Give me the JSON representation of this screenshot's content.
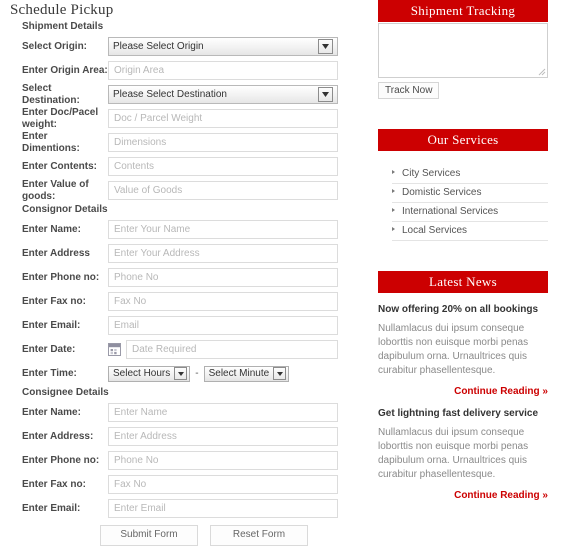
{
  "theme": {
    "accent_red": "#cc0001",
    "label_color": "#4a4a4a",
    "placeholder_color": "#b8b8b8"
  },
  "left": {
    "page_title": "Schedule Pickup",
    "shipment_section_label": "Shipment Details",
    "consignor_section_label": "Consignor Details",
    "consignee_section_label": "Consignee Details",
    "shipment_fields": [
      {
        "label": "Select Origin:",
        "type": "select",
        "value": "Please Select Origin",
        "icon": "chevron-down-icon"
      },
      {
        "label": "Enter Origin Area:",
        "type": "text",
        "placeholder": "Origin Area"
      },
      {
        "label": "Select Destination:",
        "type": "select",
        "value": "Please Select Destination",
        "icon": "chevron-down-icon"
      },
      {
        "label": "Enter Doc/Pacel weight:",
        "type": "text",
        "placeholder": "Doc / Parcel Weight"
      },
      {
        "label": "Enter Dimentions:",
        "type": "text",
        "placeholder": "Dimensions"
      },
      {
        "label": "Enter Contents:",
        "type": "text",
        "placeholder": "Contents"
      },
      {
        "label": "Enter Value of goods:",
        "type": "text",
        "placeholder": "Value of Goods"
      }
    ],
    "consignor_fields": [
      {
        "label": "Enter Name:",
        "type": "text",
        "placeholder": "Enter Your Name"
      },
      {
        "label": "Enter Address",
        "type": "text",
        "placeholder": "Enter Your Address"
      },
      {
        "label": "Enter Phone no:",
        "type": "text",
        "placeholder": "Phone No"
      },
      {
        "label": "Enter Fax no:",
        "type": "text",
        "placeholder": "Fax No"
      },
      {
        "label": "Enter Email:",
        "type": "text",
        "placeholder": "Email"
      }
    ],
    "date_field": {
      "label": "Enter Date:",
      "placeholder": "Date Required",
      "icon": "calendar-icon"
    },
    "time_field": {
      "label": "Enter Time:",
      "hours_value": "Select Hours",
      "separator": "-",
      "minutes_value": "Select Minute",
      "icon": "chevron-down-icon"
    },
    "consignee_fields": [
      {
        "label": "Enter Name:",
        "type": "text",
        "placeholder": "Enter Name"
      },
      {
        "label": "Enter Address:",
        "type": "text",
        "placeholder": "Enter Address"
      },
      {
        "label": "Enter Phone no:",
        "type": "text",
        "placeholder": "Phone No"
      },
      {
        "label": "Enter Fax no:",
        "type": "text",
        "placeholder": "Fax No"
      },
      {
        "label": "Enter Email:",
        "type": "text",
        "placeholder": "Enter Email"
      }
    ],
    "submit_label": "Submit Form",
    "reset_label": "Reset Form"
  },
  "right": {
    "tracking": {
      "header": "Shipment Tracking",
      "textarea_value": "",
      "textarea_placeholder": "",
      "button_label": "Track Now",
      "resize_icon": "resize-grip-icon"
    },
    "services": {
      "header": "Our Services",
      "items": [
        {
          "label": "City Services"
        },
        {
          "label": "Domistic Services"
        },
        {
          "label": "International Services"
        },
        {
          "label": "Local Services"
        }
      ]
    },
    "news": {
      "header": "Latest News",
      "items": [
        {
          "title": "Now offering 20% on all bookings",
          "body": "Nullamlacus dui ipsum conseque loborttis non euisque morbi penas dapibulum orna. Urnaultrices quis curabitur phasellentesque.",
          "more_label": "Continue Reading »"
        },
        {
          "title": "Get lightning fast delivery service",
          "body": "Nullamlacus dui ipsum conseque loborttis non euisque morbi penas dapibulum orna. Urnaultrices quis curabitur phasellentesque.",
          "more_label": "Continue Reading »"
        }
      ]
    }
  }
}
